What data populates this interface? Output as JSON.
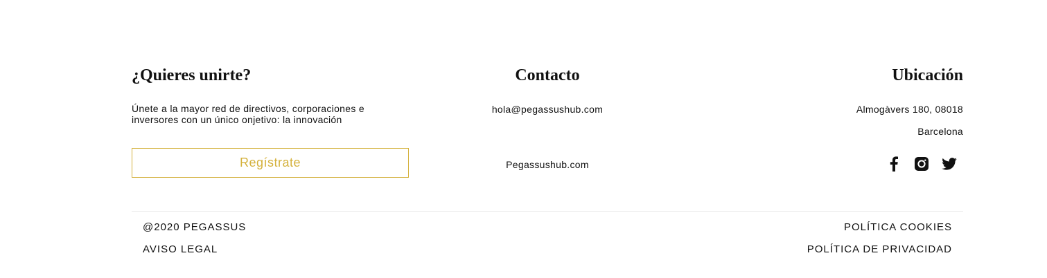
{
  "join": {
    "title": "¿Quieres unirte?",
    "text": "Únete a la mayor red de directivos, corporaciones e inversores con un único onjetivo: la innovación",
    "button_label": "Regístrate"
  },
  "contact": {
    "title": "Contacto",
    "email": "hola@pegassushub.com",
    "website": "Pegassushub.com"
  },
  "location": {
    "title": "Ubicación",
    "address_line1": "Almogàvers 180, 08018",
    "address_line2": "Barcelona",
    "social": [
      "facebook-icon",
      "instagram-icon",
      "twitter-icon"
    ]
  },
  "bottom": {
    "copyright": "@2020 PEGASSUS",
    "legal": "AVISO LEGAL",
    "cookies": "POLÍTICA COOKIES",
    "privacy": "POLÍTICA DE PRIVACIDAD"
  },
  "colors": {
    "accent": "#d4b13c",
    "text": "#111111",
    "divider": "#ececec"
  }
}
